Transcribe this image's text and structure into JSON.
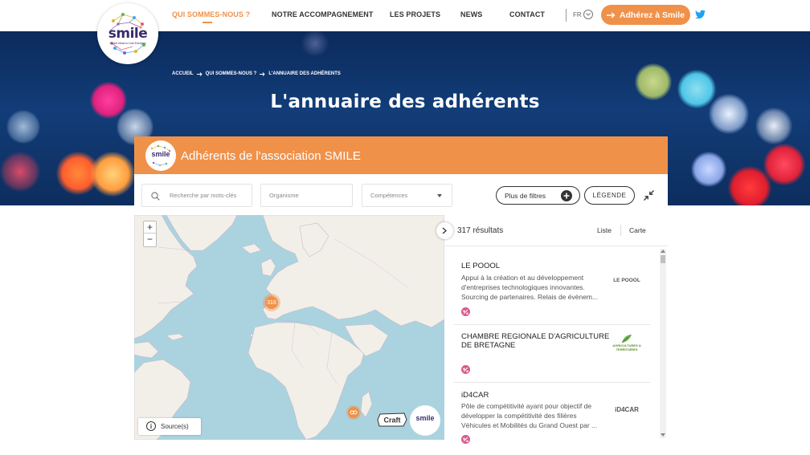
{
  "logo": {
    "word": "smile",
    "tagline": "SMart Ideas to Link Energies"
  },
  "nav": {
    "items": [
      {
        "label": "QUI SOMMES-NOUS ?",
        "active": true
      },
      {
        "label": "NOTRE ACCOMPAGNEMENT",
        "active": false
      },
      {
        "label": "LES PROJETS",
        "active": false
      },
      {
        "label": "NEWS",
        "active": false
      },
      {
        "label": "CONTACT",
        "active": false
      }
    ],
    "lang": "FR",
    "join_label": "Adhérez à Smile"
  },
  "breadcrumb": [
    "ACCUEIL",
    "QUI SOMMES-NOUS ?",
    "L'ANNUAIRE DES ADHÉRENTS"
  ],
  "page_title": "L'annuaire des adhérents",
  "directory": {
    "logo_word": "smile",
    "title": "Adhérents de l'association SMILE",
    "search_placeholder": "Recherche par mots-clés",
    "organisme_placeholder": "Organisme",
    "competences_placeholder": "Compétences",
    "more_filters_label": "Plus de filtres",
    "legend_label": "LÉGENDE"
  },
  "map": {
    "zoom_in": "+",
    "zoom_out": "−",
    "clusters": [
      {
        "count": "316"
      },
      {
        "count": ""
      }
    ],
    "source_label": "Source(s)",
    "craft_label": "Craft",
    "smile_label": "smile"
  },
  "results": {
    "count_label": "317 résultats",
    "view_list": "Liste",
    "view_map": "Carte",
    "items": [
      {
        "name": "LE POOOL",
        "description": "Appui à la création et au développement d'entreprises technologiques innovantes. Sourcing de partenaires. Relais de évènem...",
        "logo_text": "LE POOOL"
      },
      {
        "name": "CHAMBRE REGIONALE D'AGRICULTURE DE BRETAGNE",
        "description": "",
        "logo_text": "AGRICULTURES & TERRITOIRES"
      },
      {
        "name": "iD4CAR",
        "description": "Pôle de compétitivité ayant pour objectif de développer la compétitivité des filières Véhicules et Mobilités du Grand Ouest par ...",
        "logo_text": "iD4CAR"
      }
    ]
  },
  "colors": {
    "brand_orange": "#f0914a",
    "logo_purple": "#3a2d6b",
    "tag_pink": "#d85a8c",
    "hero_blue": "#123d78",
    "map_water": "#aad3df",
    "map_land": "#f2efe9"
  },
  "icons": [
    "search-icon",
    "chevron-down-icon",
    "arrow-right-icon",
    "twitter-icon",
    "plus-icon",
    "collapse-icon",
    "info-icon",
    "chevron-right-icon",
    "tag-icon"
  ]
}
